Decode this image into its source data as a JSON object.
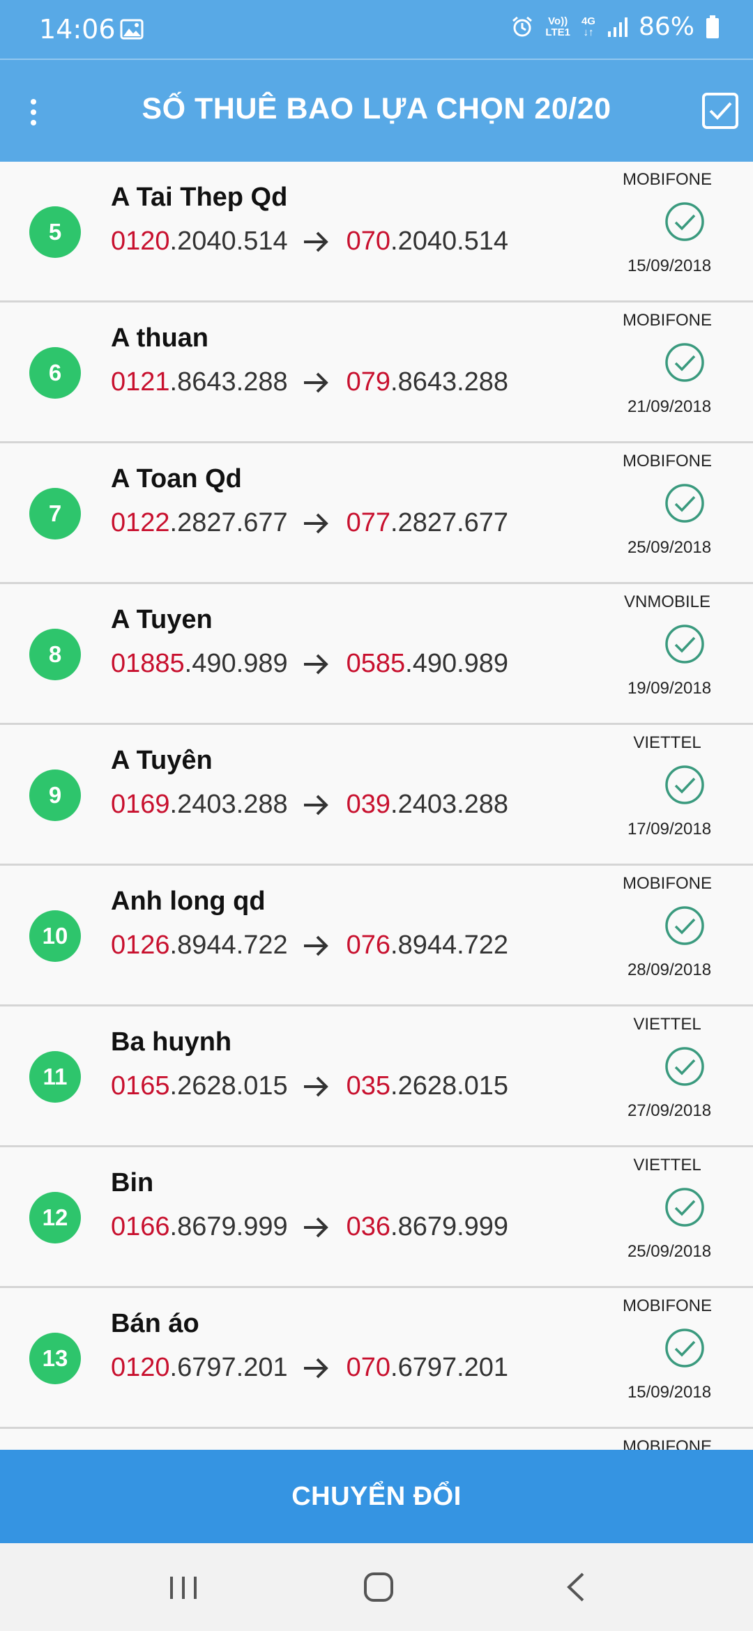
{
  "status_bar": {
    "time": "14:06",
    "network_top": "Vo))",
    "network_bottom": "LTE1",
    "network_type": "4G",
    "battery": "86%"
  },
  "app_bar": {
    "title": "SỐ THUÊ BAO LỰA CHỌN 20/20",
    "menu_icon": "more-vert-icon",
    "select_all_icon": "checkbox-checked-icon"
  },
  "colors": {
    "primary": "#58a9e6",
    "button": "#3594e2",
    "badge": "#2ec56c",
    "prefix": "#c8102e",
    "check": "#3a9a7e"
  },
  "contacts": [
    {
      "index": "5",
      "name": "A Tai Thep Qd",
      "old_prefix": "0120",
      "old_rest": ".2040.514",
      "new_prefix": "070",
      "new_rest": ".2040.514",
      "carrier": "MOBIFONE",
      "date": "15/09/2018"
    },
    {
      "index": "6",
      "name": "A thuan",
      "old_prefix": "0121",
      "old_rest": ".8643.288",
      "new_prefix": "079",
      "new_rest": ".8643.288",
      "carrier": "MOBIFONE",
      "date": "21/09/2018"
    },
    {
      "index": "7",
      "name": "A Toan Qd",
      "old_prefix": "0122",
      "old_rest": ".2827.677",
      "new_prefix": "077",
      "new_rest": ".2827.677",
      "carrier": "MOBIFONE",
      "date": "25/09/2018"
    },
    {
      "index": "8",
      "name": "A Tuyen",
      "old_prefix": "01885",
      "old_rest": ".490.989",
      "new_prefix": "0585",
      "new_rest": ".490.989",
      "carrier": "VNMOBILE",
      "date": "19/09/2018"
    },
    {
      "index": "9",
      "name": "A Tuyên",
      "old_prefix": "0169",
      "old_rest": ".2403.288",
      "new_prefix": "039",
      "new_rest": ".2403.288",
      "carrier": "VIETTEL",
      "date": "17/09/2018"
    },
    {
      "index": "10",
      "name": "Anh long qd",
      "old_prefix": "0126",
      "old_rest": ".8944.722",
      "new_prefix": "076",
      "new_rest": ".8944.722",
      "carrier": "MOBIFONE",
      "date": "28/09/2018"
    },
    {
      "index": "11",
      "name": "Ba huynh",
      "old_prefix": "0165",
      "old_rest": ".2628.015",
      "new_prefix": "035",
      "new_rest": ".2628.015",
      "carrier": "VIETTEL",
      "date": "27/09/2018"
    },
    {
      "index": "12",
      "name": "Bin",
      "old_prefix": "0166",
      "old_rest": ".8679.999",
      "new_prefix": "036",
      "new_rest": ".8679.999",
      "carrier": "VIETTEL",
      "date": "25/09/2018"
    },
    {
      "index": "13",
      "name": "Bán áo",
      "old_prefix": "0120",
      "old_rest": ".6797.201",
      "new_prefix": "070",
      "new_rest": ".6797.201",
      "carrier": "MOBIFONE",
      "date": "15/09/2018"
    }
  ],
  "partial_row": {
    "carrier": "MOBIFONE"
  },
  "convert_button": "CHUYỂN ĐỔI",
  "nav": {
    "recent_icon": "recent-apps-icon",
    "home_icon": "home-icon",
    "back_icon": "back-icon"
  }
}
